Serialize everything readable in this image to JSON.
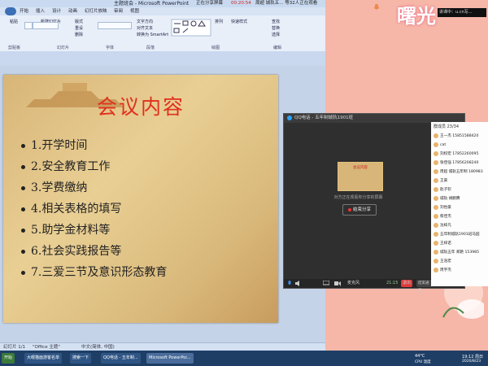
{
  "ppt": {
    "window_title": "主题班会 - Microsoft PowerPoint",
    "share_indicator": "正在分享屏幕",
    "share_time": "00:20:54",
    "share_status": "周超 城轨五... 等32人正在观看",
    "tabs": [
      "开始",
      "插入",
      "设计",
      "动画",
      "幻灯片放映",
      "审阅",
      "视图"
    ],
    "ribbon_groups": [
      "剪贴板",
      "幻灯片",
      "字体",
      "段落",
      "绘图",
      "编辑"
    ],
    "ribbon_items": {
      "paste": "粘贴",
      "new_slide": "新建幻灯片",
      "layout": "版式",
      "reset": "重设",
      "delete": "删除",
      "text_direction": "文字方向",
      "align_text": "对齐文本",
      "smartart": "转换为 SmartArt",
      "arrange": "排列",
      "quick_styles": "快速样式",
      "find": "查找",
      "replace": "替换",
      "select": "选择"
    },
    "status_slide": "幻灯片 1/1",
    "status_theme": "\"Office 主题\"",
    "status_lang": "中文(简体, 中国)"
  },
  "slide": {
    "title": "会议内容",
    "bullets": [
      "1.开学时间",
      "2.安全教育工作",
      "3.学费缴纳",
      "4.相关表格的填写",
      "5.助学金材料等",
      "6.社会实践报告等",
      "7.三爱三节及意识形态教育"
    ]
  },
  "qq": {
    "title": "QQ电话 - 五年制城轨1901班",
    "preview_title": "会议内容",
    "sharing_message": "对方正在观看你分享的屏幕",
    "stop_button": "结束分享",
    "mic_label": "麦克风",
    "time": "21:15",
    "exit_button": "退出",
    "end_call_button": "结束通话",
    "member_count": "群成员 23/34",
    "members": [
      "王一杰 15851588420",
      "cat",
      "刘权宏 17852260095",
      "张佳强 17856208240",
      "周超 城轨五年制 180983",
      "王豪",
      "赵子钦",
      "城轨 胡鹏腾",
      "刘怡豪",
      "蔡佳杰",
      "沈梓凡",
      "五年制城轨1901班马园",
      "王梓诺",
      "城轨五年 郑艳 153985",
      "王浩宏",
      "周宇杰"
    ]
  },
  "camera": {
    "label": "讲课中：u.cn写..."
  },
  "deco": {
    "title": "曙光"
  },
  "taskbar": {
    "start": "开始",
    "items": [
      "大眼猫面游客名单",
      "搜索一下",
      "QQ电话 - 五年制...",
      "Microsoft PowerPoi..."
    ],
    "weather": "44°C",
    "weather_sub": "CPU 温度",
    "time": "19:12 周日",
    "date": "2020/8/23"
  },
  "colors": {
    "title_red": "#e0301e",
    "qq_dark": "#2b2b2b",
    "taskbar": "#1e3e66",
    "deco_pink": "#f6b6a8"
  }
}
